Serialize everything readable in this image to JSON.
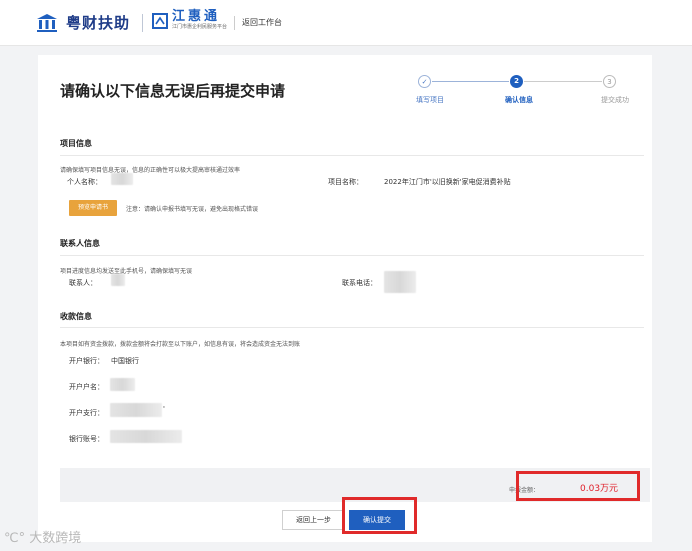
{
  "header": {
    "brand1": "粤财扶助",
    "brand2_name": "江惠通",
    "brand2_sub": "江门市惠企利民服务平台",
    "back_to_workbench": "返回工作台"
  },
  "page": {
    "title": "请确认以下信息无误后再提交申请"
  },
  "steps": [
    {
      "num": "",
      "label": "填写项目",
      "state": "done"
    },
    {
      "num": "2",
      "label": "确认信息",
      "state": "active"
    },
    {
      "num": "3",
      "label": "提交成功",
      "state": "pending"
    }
  ],
  "project_section": {
    "title": "项目信息",
    "hint": "请确保填写项目信息无误，信息的正确性可以极大提高审核通过效率",
    "person_label": "个人名称：",
    "project_label": "项目名称：",
    "project_value": "2022年江门市'以旧换新'家电促消费补贴",
    "download_button": "预览申请书",
    "note": "注意：请确认申报书填写无误，避免出现格式错误"
  },
  "contact_section": {
    "title": "联系人信息",
    "hint": "项目进度信息均发送至此手机号，请确保填写无误",
    "contact_label": "联系人：",
    "phone_label": "联系电话："
  },
  "payment_section": {
    "title": "收款信息",
    "hint": "本项目如有资金拨款，拨款金额将会打款至以下账户，如信息有误，将会造成资金无法到账",
    "bank_label": "开户银行：",
    "bank_value": "中国银行",
    "account_name_label": "开户户名：",
    "branch_label": "开户支行：",
    "branch_suffix": "'",
    "account_no_label": "银行账号："
  },
  "summary": {
    "amount_label": "申报金额：",
    "amount_value": "0.03万元"
  },
  "actions": {
    "back_label": "返回上一步",
    "submit_label": "确认提交"
  },
  "watermark": "大数跨境",
  "colors": {
    "primary": "#1f5fbf",
    "orange": "#e8a33c",
    "highlight_red": "#e02a2a",
    "amount_red": "#e0202a"
  }
}
